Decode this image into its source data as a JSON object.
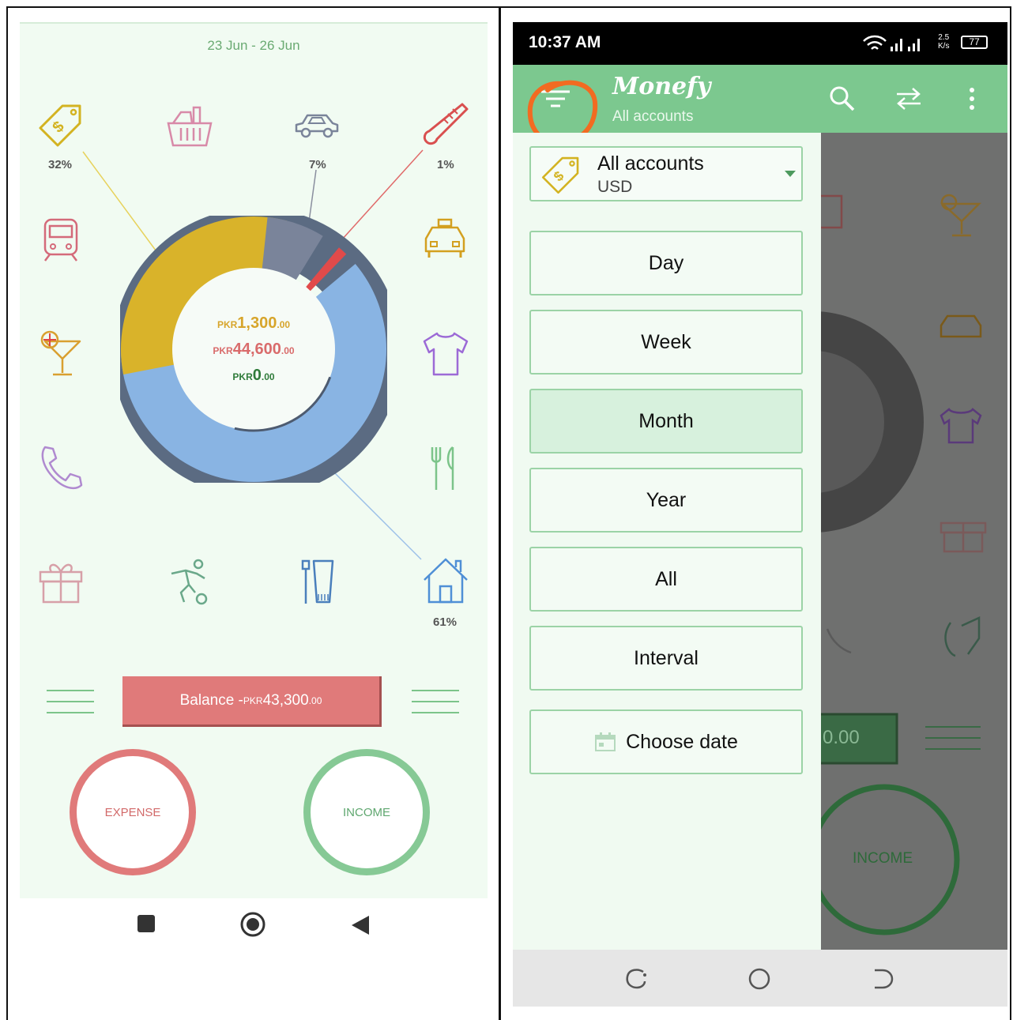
{
  "left": {
    "date_range": "23 Jun - 26 Jun",
    "percentages": {
      "top_left": "32%",
      "car": "7%",
      "thermometer": "1%",
      "house": "61%"
    },
    "center": {
      "expense": {
        "currency": "PKR",
        "int": "1,300",
        "dec": ".00"
      },
      "income": {
        "currency": "PKR",
        "int": "44,600",
        "dec": ".00"
      },
      "balance": {
        "currency": "PKR",
        "int": "0",
        "dec": ".00"
      }
    },
    "balance_bar": {
      "label": "Balance -",
      "currency": "PKR",
      "int": "43,300",
      "dec": ".00"
    },
    "expense_button": "EXPENSE",
    "income_button": "INCOME"
  },
  "right": {
    "status": {
      "time": "10:37 AM",
      "speed": "2.5",
      "speed_unit": "K/s",
      "battery": "77"
    },
    "app": {
      "title": "Monefy",
      "subtitle": "All accounts"
    },
    "account": {
      "name": "All accounts",
      "currency": "USD"
    },
    "periods": [
      "Day",
      "Week",
      "Month",
      "Year",
      "All",
      "Interval"
    ],
    "choose_date": "Choose date",
    "bg_amount": "0.00",
    "bg_income": "INCOME"
  },
  "colors": {
    "green": "#7cc88f",
    "expense_red": "#e07a7a",
    "income_green": "#86c995",
    "chart_yellow": "#d9b32a",
    "chart_blue": "#89b4e3",
    "chart_gray": "#7a849a",
    "chart_red": "#e14a4a",
    "highlight_orange": "#f26b21"
  }
}
